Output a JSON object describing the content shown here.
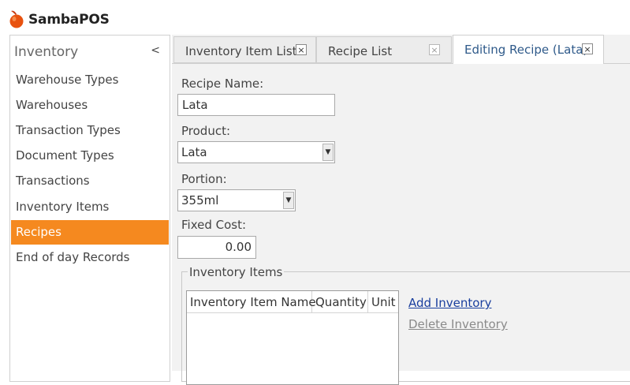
{
  "app": {
    "title": "SambaPOS"
  },
  "sidebar": {
    "title": "Inventory",
    "collapse_glyph": "<",
    "items": [
      {
        "label": "Warehouse Types"
      },
      {
        "label": "Warehouses"
      },
      {
        "label": "Transaction Types"
      },
      {
        "label": "Document Types"
      },
      {
        "label": "Transactions"
      },
      {
        "label": "Inventory Items"
      },
      {
        "label": "Recipes",
        "active": true
      },
      {
        "label": "End of day Records"
      }
    ]
  },
  "tabs": [
    {
      "label": "Inventory Item List",
      "close": "×"
    },
    {
      "label": "Recipe List",
      "close": "×"
    },
    {
      "label": "Editing Recipe (Lata)",
      "close": "×",
      "active": true
    }
  ],
  "form": {
    "recipe_name_label": "Recipe Name:",
    "recipe_name_value": "Lata",
    "product_label": "Product:",
    "product_value": "Lata",
    "portion_label": "Portion:",
    "portion_value": "355ml",
    "fixed_cost_label": "Fixed Cost:",
    "fixed_cost_value": "0.00"
  },
  "inventory_items": {
    "group_title": "Inventory Items",
    "columns": [
      "Inventory Item Name",
      "Quantity",
      "Unit"
    ],
    "rows": [],
    "add_label": "Add Inventory",
    "delete_label": "Delete Inventory"
  },
  "colors": {
    "accent": "#f5891f",
    "link": "#1a3f9e",
    "active_tab_text": "#2f5a8a"
  }
}
